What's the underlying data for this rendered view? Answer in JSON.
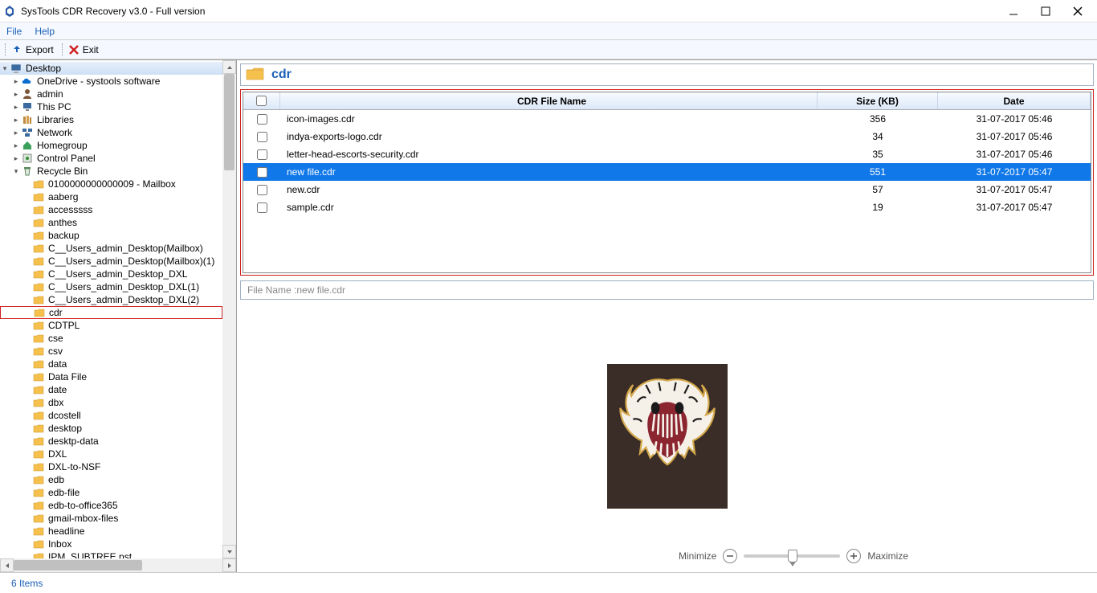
{
  "window": {
    "title": "SysTools CDR Recovery v3.0  -  Full version"
  },
  "menu": {
    "file": "File",
    "help": "Help"
  },
  "toolbar": {
    "export": "Export",
    "exit": "Exit"
  },
  "tree": {
    "root": "Desktop",
    "top_items": [
      {
        "label": "OneDrive - systools software",
        "icon": "cloud"
      },
      {
        "label": "admin",
        "icon": "user"
      },
      {
        "label": "This PC",
        "icon": "pc"
      },
      {
        "label": "Libraries",
        "icon": "lib"
      },
      {
        "label": "Network",
        "icon": "net"
      },
      {
        "label": "Homegroup",
        "icon": "home"
      },
      {
        "label": "Control Panel",
        "icon": "control"
      }
    ],
    "recycle": "Recycle Bin",
    "folders": [
      "0100000000000009 - Mailbox",
      "aaberg",
      "accesssss",
      "anthes",
      "backup",
      "C__Users_admin_Desktop(Mailbox)",
      "C__Users_admin_Desktop(Mailbox)(1)",
      "C__Users_admin_Desktop_DXL",
      "C__Users_admin_Desktop_DXL(1)",
      "C__Users_admin_Desktop_DXL(2)",
      "cdr",
      "CDTPL",
      "cse",
      "csv",
      "data",
      "Data File",
      "date",
      "dbx",
      "dcostell",
      "desktop",
      "desktp-data",
      "DXL",
      "DXL-to-NSF",
      "edb",
      "edb-file",
      "edb-to-office365",
      "gmail-mbox-files",
      "headline",
      "Inbox",
      "IPM_SUBTREE.pst"
    ],
    "selected": "cdr"
  },
  "breadcrumb": {
    "path": "cdr"
  },
  "table": {
    "headers": {
      "name": "CDR File Name",
      "size": "Size (KB)",
      "date": "Date"
    },
    "rows": [
      {
        "name": "icon-images.cdr",
        "size": "356",
        "date": "31-07-2017 05:46"
      },
      {
        "name": "indya-exports-logo.cdr",
        "size": "34",
        "date": "31-07-2017 05:46"
      },
      {
        "name": "letter-head-escorts-security.cdr",
        "size": "35",
        "date": "31-07-2017 05:46"
      },
      {
        "name": "new file.cdr",
        "size": "551",
        "date": "31-07-2017 05:47"
      },
      {
        "name": "new.cdr",
        "size": "57",
        "date": "31-07-2017 05:47"
      },
      {
        "name": "sample.cdr",
        "size": "19",
        "date": "31-07-2017 05:47"
      }
    ],
    "selected_index": 3
  },
  "preview": {
    "label_prefix": "File Name : ",
    "filename": "new file.cdr"
  },
  "zoom": {
    "min_label": "Minimize",
    "max_label": "Maximize"
  },
  "status": {
    "text": "6 Items"
  }
}
